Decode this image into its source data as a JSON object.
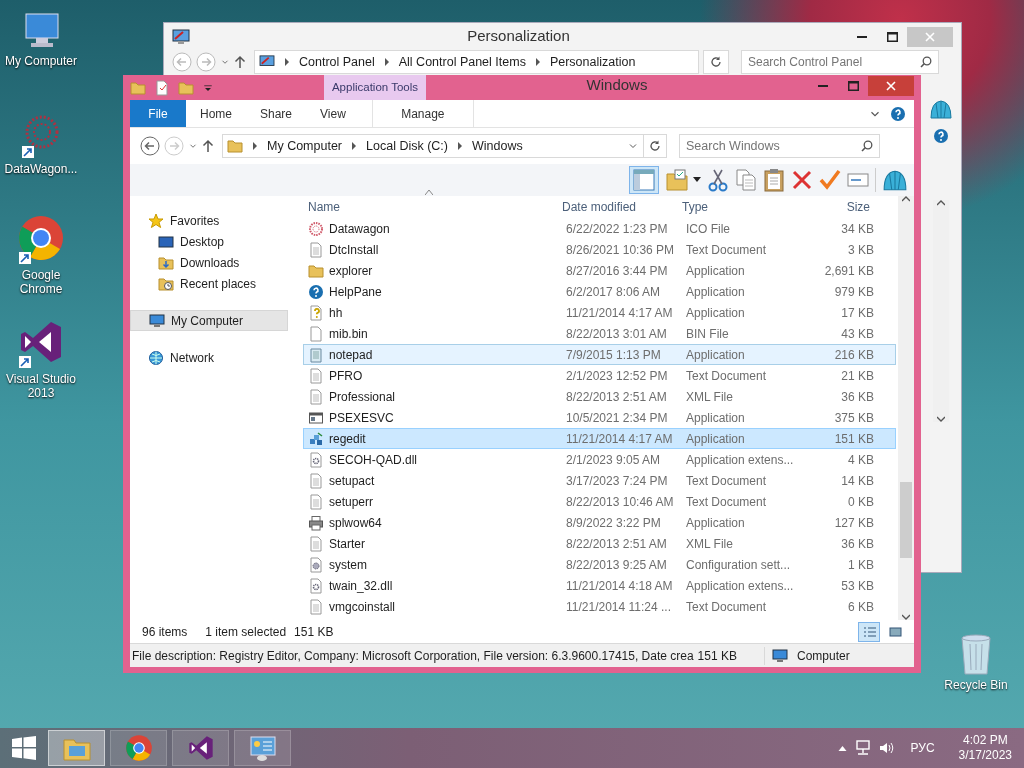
{
  "desktop_icons": [
    {
      "label": "My Computer"
    },
    {
      "label": "DataWagon..."
    },
    {
      "label": "Google Chrome"
    },
    {
      "label": "Visual Studio 2013"
    },
    {
      "label": "Recycle Bin"
    }
  ],
  "personalization_window": {
    "title": "Personalization",
    "breadcrumb": [
      "Control Panel",
      "All Control Panel Items",
      "Personalization"
    ],
    "search": {
      "placeholder": "Search Control Panel"
    }
  },
  "explorer_window": {
    "title": "Windows",
    "context_tab_group": "Application Tools",
    "ribbon_tabs": [
      {
        "label": "File",
        "kind": "file",
        "selected": false
      },
      {
        "label": "Home",
        "kind": "normal",
        "selected": false
      },
      {
        "label": "Share",
        "kind": "normal",
        "selected": false
      },
      {
        "label": "View",
        "kind": "normal",
        "selected": false
      },
      {
        "label": "Manage",
        "kind": "context",
        "selected": false
      }
    ],
    "breadcrumb": [
      "My Computer",
      "Local Disk (C:)",
      "Windows"
    ],
    "search": {
      "placeholder": "Search Windows"
    },
    "navigation": [
      {
        "label": "Favorites",
        "selected": false,
        "children": [
          {
            "label": "Desktop",
            "selected": false
          },
          {
            "label": "Downloads",
            "selected": false
          },
          {
            "label": "Recent places",
            "selected": false
          }
        ]
      },
      {
        "label": "My Computer",
        "selected": true
      },
      {
        "label": "Network",
        "selected": false
      }
    ],
    "columns": [
      "Name",
      "Date modified",
      "Type",
      "Size"
    ],
    "files": [
      {
        "name": "Datawagon",
        "date": "6/22/2022 1:23 PM",
        "type": "ICO File",
        "size": "34 KB",
        "selected": false,
        "hovered": false
      },
      {
        "name": "DtcInstall",
        "date": "8/26/2021 10:36 PM",
        "type": "Text Document",
        "size": "3 KB",
        "selected": false,
        "hovered": false
      },
      {
        "name": "explorer",
        "date": "8/27/2016 3:44 PM",
        "type": "Application",
        "size": "2,691 KB",
        "selected": false,
        "hovered": false
      },
      {
        "name": "HelpPane",
        "date": "6/2/2017 8:06 AM",
        "type": "Application",
        "size": "979 KB",
        "selected": false,
        "hovered": false
      },
      {
        "name": "hh",
        "date": "11/21/2014 4:17 AM",
        "type": "Application",
        "size": "17 KB",
        "selected": false,
        "hovered": false
      },
      {
        "name": "mib.bin",
        "date": "8/22/2013 3:01 AM",
        "type": "BIN File",
        "size": "43 KB",
        "selected": false,
        "hovered": false
      },
      {
        "name": "notepad",
        "date": "7/9/2015 1:13 PM",
        "type": "Application",
        "size": "216 KB",
        "selected": false,
        "hovered": true
      },
      {
        "name": "PFRO",
        "date": "2/1/2023 12:52 PM",
        "type": "Text Document",
        "size": "21 KB",
        "selected": false,
        "hovered": false
      },
      {
        "name": "Professional",
        "date": "8/22/2013 2:51 AM",
        "type": "XML File",
        "size": "36 KB",
        "selected": false,
        "hovered": false
      },
      {
        "name": "PSEXESVC",
        "date": "10/5/2021 2:34 PM",
        "type": "Application",
        "size": "375 KB",
        "selected": false,
        "hovered": false
      },
      {
        "name": "regedit",
        "date": "11/21/2014 4:17 AM",
        "type": "Application",
        "size": "151 KB",
        "selected": true,
        "hovered": false
      },
      {
        "name": "SECOH-QAD.dll",
        "date": "2/1/2023 9:05 AM",
        "type": "Application extens...",
        "size": "4 KB",
        "selected": false,
        "hovered": false
      },
      {
        "name": "setupact",
        "date": "3/17/2023 7:24 PM",
        "type": "Text Document",
        "size": "14 KB",
        "selected": false,
        "hovered": false
      },
      {
        "name": "setuperr",
        "date": "8/22/2013 10:46 AM",
        "type": "Text Document",
        "size": "0 KB",
        "selected": false,
        "hovered": false
      },
      {
        "name": "splwow64",
        "date": "8/9/2022 3:22 PM",
        "type": "Application",
        "size": "127 KB",
        "selected": false,
        "hovered": false
      },
      {
        "name": "Starter",
        "date": "8/22/2013 2:51 AM",
        "type": "XML File",
        "size": "36 KB",
        "selected": false,
        "hovered": false
      },
      {
        "name": "system",
        "date": "8/22/2013 9:25 AM",
        "type": "Configuration sett...",
        "size": "1 KB",
        "selected": false,
        "hovered": false
      },
      {
        "name": "twain_32.dll",
        "date": "11/21/2014 4:18 AM",
        "type": "Application extens...",
        "size": "53 KB",
        "selected": false,
        "hovered": false
      },
      {
        "name": "vmgcoinstall",
        "date": "11/21/2014 11:24 ...",
        "type": "Text Document",
        "size": "6 KB",
        "selected": false,
        "hovered": false
      }
    ],
    "status": {
      "item_count": "96 items",
      "selection": "1 item selected",
      "selection_size": "151 KB"
    },
    "view_modes": [
      {
        "selected": true
      },
      {
        "selected": false
      }
    ],
    "details_bar": {
      "description": "File description: Registry Editor, Company: Microsoft Corporation, File version: 6.3.9600.17415, Date crea",
      "size": "151 KB",
      "zone": "Computer"
    }
  },
  "taskbar": {
    "apps": [
      {
        "selected": true
      },
      {
        "selected": false
      },
      {
        "selected": false
      },
      {
        "selected": false
      }
    ],
    "tray": {
      "language": "РУС",
      "time": "4:02 PM",
      "date": "3/17/2023"
    }
  }
}
